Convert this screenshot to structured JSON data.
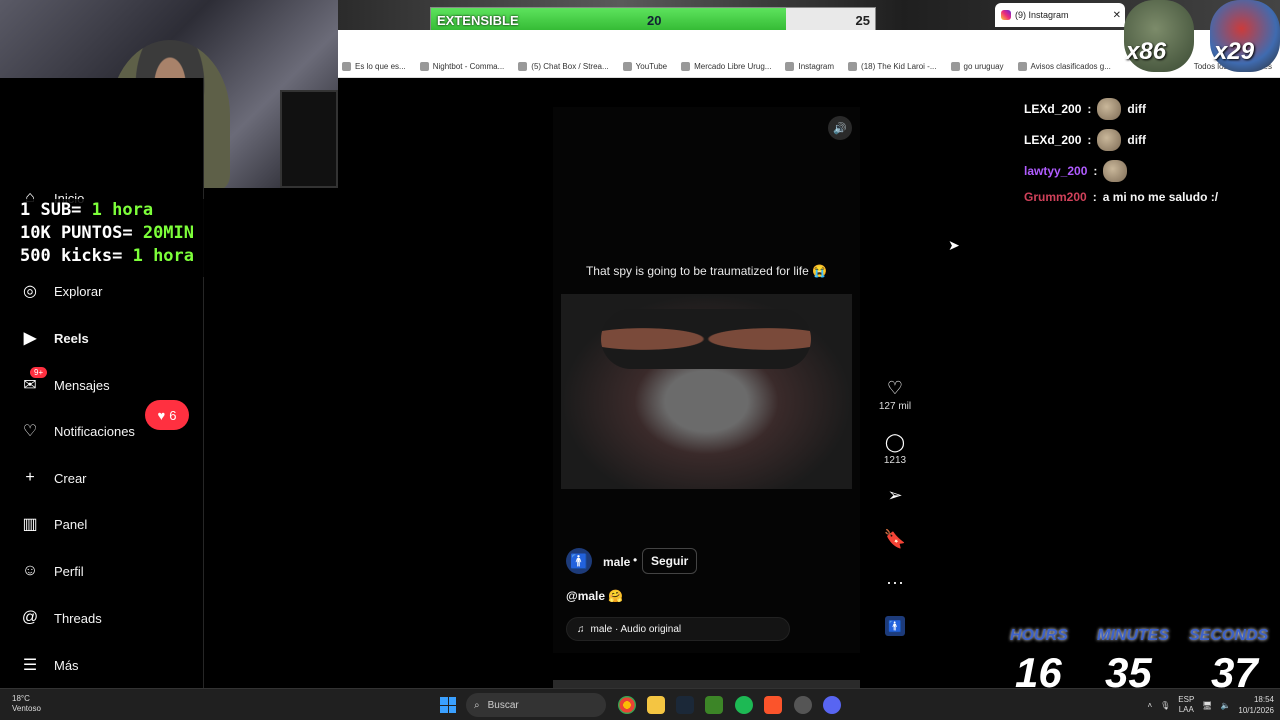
{
  "progress": {
    "label": "EXTENSIBLE",
    "value": "20",
    "target": "25",
    "fill_fraction": 0.8
  },
  "tab": {
    "title": "(9) Instagram"
  },
  "bookmarks": {
    "items": [
      "Es lo que es...",
      "Nightbot - Comma...",
      "(5) Chat Box / Strea...",
      "YouTube",
      "Mercado Libre Urug...",
      "Instagram",
      "(18) The Kid Laroi -...",
      "go uruguay",
      "Avisos clasificados g..."
    ],
    "all_label": "Todos los marcadores"
  },
  "overlay": {
    "line1_a": "1 SUB= ",
    "line1_b": "1 hora",
    "line2_a": "10K PUNTOS= ",
    "line2_b": "20MIN",
    "line3_a": "500 kicks= ",
    "line3_b": "1 hora"
  },
  "sidebar": {
    "items": [
      {
        "label": "Inicio",
        "icon": "home-icon"
      },
      {
        "label": "Explorar",
        "icon": "compass-icon"
      },
      {
        "label": "Reels",
        "icon": "reels-icon"
      },
      {
        "label": "Mensajes",
        "icon": "messages-icon",
        "badge": "9+"
      },
      {
        "label": "Notificaciones",
        "icon": "heart-icon"
      },
      {
        "label": "Crear",
        "icon": "plus-icon"
      },
      {
        "label": "Panel",
        "icon": "chart-icon"
      },
      {
        "label": "Perfil",
        "icon": "avatar-icon"
      },
      {
        "label": "Threads",
        "icon": "threads-icon"
      },
      {
        "label": "Más",
        "icon": "menu-icon"
      }
    ],
    "notification_count": "6"
  },
  "reel": {
    "caption": "That spy is going to be traumatized for life 😭",
    "author": "male",
    "follow_label": "Seguir",
    "handle": "@male 🤗",
    "audio": "male · Audio original",
    "likes": "127 mil",
    "comments": "1213"
  },
  "chat": {
    "messages": [
      {
        "user": "LEXd_200",
        "text": "diff",
        "color": "#ffffff"
      },
      {
        "user": "LEXd_200",
        "text": "diff",
        "color": "#ffffff"
      },
      {
        "user": "lawtyy_200",
        "text": "",
        "color": "#b05cff"
      },
      {
        "user": "Grumm200",
        "text": "a mi no me saludo :/",
        "color": "#d0415a"
      }
    ],
    "counter_a": "x86",
    "counter_b": "x29"
  },
  "timer": {
    "hours_label": "HOURS",
    "minutes_label": "MINUTES",
    "seconds_label": "SECONDS",
    "hours": "16",
    "minutes": "35",
    "seconds": "37"
  },
  "taskbar": {
    "temp": "18°C",
    "weather": "Ventoso",
    "search_placeholder": "Buscar",
    "lang_a": "ESP",
    "lang_b": "LAA",
    "time": "18:54",
    "date": "10/1/2026"
  }
}
